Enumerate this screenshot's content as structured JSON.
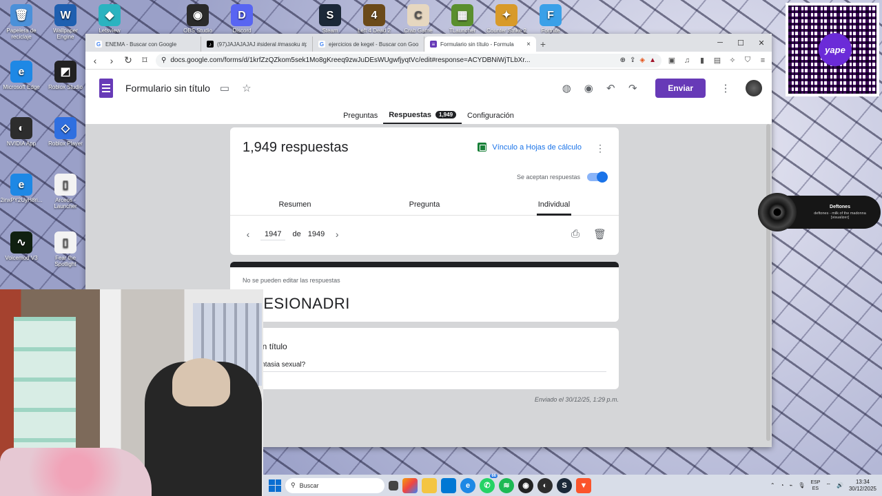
{
  "desktop": {
    "icons": [
      {
        "label": "Papelera de reciclaje",
        "color": "#4a90d9",
        "glyph": "🗑"
      },
      {
        "label": "Wallpaper Engine",
        "color": "#1e5fb0",
        "glyph": "W"
      },
      {
        "label": "Letsview",
        "color": "#2bb3c0",
        "glyph": "◆"
      },
      {
        "label": "OBS Studio",
        "color": "#2a2a2a",
        "glyph": "◉"
      },
      {
        "label": "Discord",
        "color": "#5865f2",
        "glyph": "D"
      },
      {
        "label": "Steam",
        "color": "#1b2838",
        "glyph": "S"
      },
      {
        "label": "Left 4 Dead 2",
        "color": "#6b4a1a",
        "glyph": "4"
      },
      {
        "label": "Crab Game",
        "color": "#e6d7c0",
        "glyph": "C"
      },
      {
        "label": "TLauncher",
        "color": "#5a8f2e",
        "glyph": "▦"
      },
      {
        "label": "Counter Strike 2",
        "color": "#d89a2a",
        "glyph": "✦"
      },
      {
        "label": "Fortnite",
        "color": "#3aa0e8",
        "glyph": "F"
      },
      {
        "label": "Microsoft Edge",
        "color": "#1e88e5",
        "glyph": "e"
      },
      {
        "label": "Roblox Studio",
        "color": "#222",
        "glyph": "◩"
      },
      {
        "label": "NVIDIA App",
        "color": "#2d2d2d",
        "glyph": "◐"
      },
      {
        "label": "Roblox Player",
        "color": "#2f6fe0",
        "glyph": "◇"
      },
      {
        "label": "2inxPY2UyH8ri...",
        "color": "#1e88e5",
        "glyph": "e"
      },
      {
        "label": "Arceos - Launcher",
        "color": "#f3f3f3",
        "glyph": "▯"
      },
      {
        "label": "Voicemod V3",
        "color": "#102010",
        "glyph": "∿"
      },
      {
        "label": "Fear the Spotlight",
        "color": "#f3f3f3",
        "glyph": "▯"
      }
    ],
    "qr_text": "yape"
  },
  "browser": {
    "tabs": [
      {
        "title": "ENEMA - Buscar con Google",
        "favicon": "G",
        "color": "#fff",
        "fg": "#4285f4"
      },
      {
        "title": "(97)JAJAJAJAJ #sideral #masoku #pa",
        "favicon": "♪",
        "color": "#000",
        "fg": "#fff"
      },
      {
        "title": "ejercicios de kegel - Buscar con Goo",
        "favicon": "G",
        "color": "#fff",
        "fg": "#4285f4"
      },
      {
        "title": "Formulario sin título - Formula",
        "favicon": "≡",
        "color": "#673ab7",
        "fg": "#fff"
      }
    ],
    "new_tab": "+",
    "minimize": "─",
    "maximize": "☐",
    "close": "✕",
    "url": "docs.google.com/forms/d/1krfZzQZkom5sek1Mo8gKreeq9zwJuDEsWUgwfjyqtVc/edit#response=ACYDBNiWjTLbXr..."
  },
  "form": {
    "title": "Formulario sin título",
    "send_label": "Enviar",
    "tabs": {
      "questions": "Preguntas",
      "responses": "Respuestas",
      "responses_count": "1,949",
      "settings": "Configuración"
    },
    "responses_title": "1,949 respuestas",
    "sheets_link": "Vínculo a Hojas de cálculo",
    "accepting_label": "Se aceptan respuestas",
    "subtabs": {
      "summary": "Resumen",
      "question": "Pregunta",
      "individual": "Individual"
    },
    "pager": {
      "current": "1947",
      "of": "de",
      "total": "1949"
    },
    "response": {
      "notice": "No se pueden editar las respuestas",
      "name": "NFESIONADRI",
      "question_title": "nta sin título",
      "answer": "s tu fantasia sexual?",
      "sent": "Enviado el 30/12/25, 1:29 p.m."
    }
  },
  "music_widget": {
    "title": "Deftones",
    "subtitle": "deftones - milk of the madonna\n[visualizer]"
  },
  "taskbar": {
    "search_placeholder": "Buscar",
    "whatsapp_badge": "66",
    "lang_top": "ESP",
    "lang_bottom": "ES",
    "time": "13:34",
    "date": "30/12/2025"
  }
}
